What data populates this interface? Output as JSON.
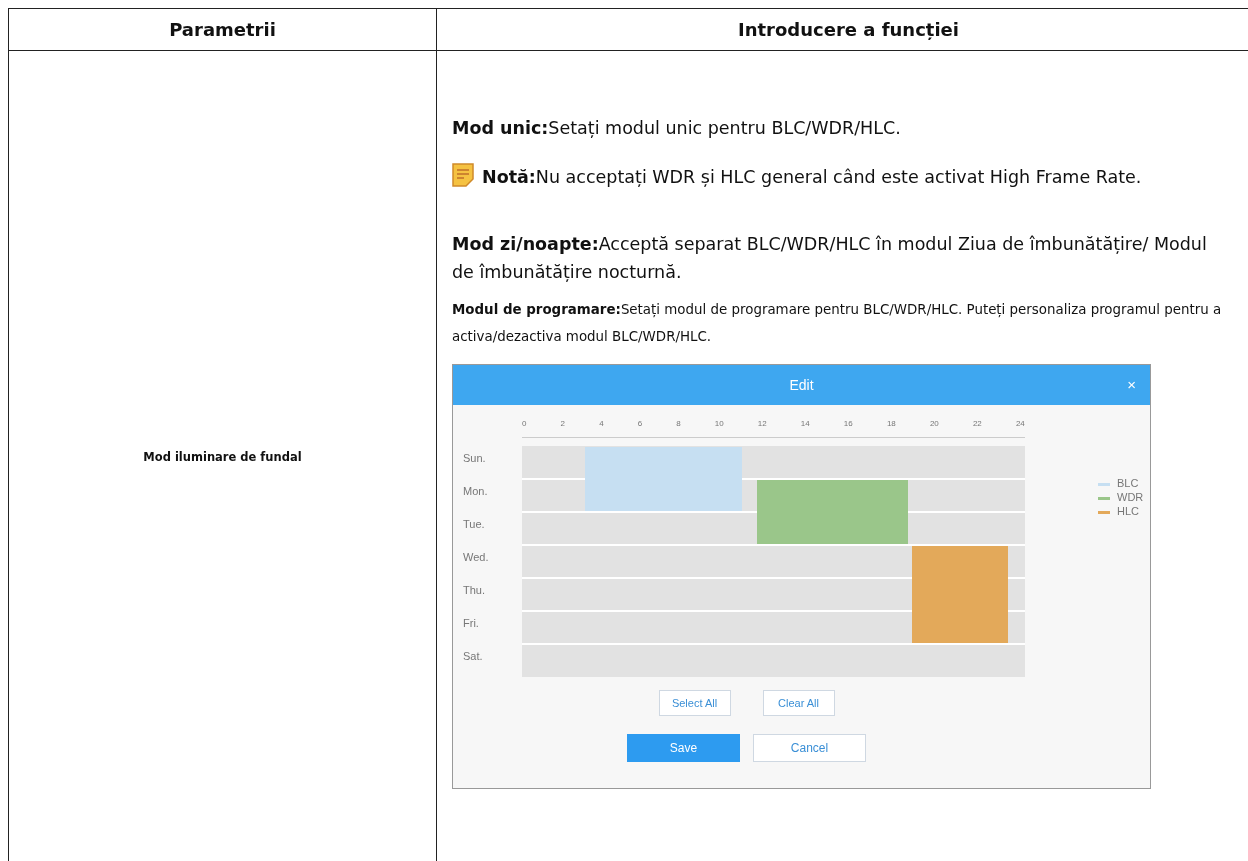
{
  "table": {
    "columns": [
      "Parametrii",
      "Introducere a funcției"
    ],
    "rows": [
      {
        "parameter": "Mod iluminare de fundal",
        "description": [
          {
            "kind": "paragraph",
            "text": "**Mod unic:**Setați modul unic pentru BLC/WDR/HLC."
          },
          {
            "kind": "note",
            "text": "**Notă:**Nu acceptați WDR și HLC general când este activat High Frame Rate."
          },
          {
            "kind": "paragraph",
            "text": "**Mod zi/noapte:**Acceptă separat BLC/WDR/HLC în modul Ziua de îmbunătățire/ Modul de îmbunătățire nocturnă."
          },
          {
            "kind": "small",
            "text": "**Modul de programare:**Setați modul de programare pentru BLC/WDR/HLC. Puteți personaliza programul pentru a activa/dezactiva modul BLC/WDR/HLC."
          }
        ],
        "dialog": {
          "title": "Edit",
          "close": "×",
          "hours": [
            "0",
            "2",
            "4",
            "6",
            "8",
            "10",
            "12",
            "14",
            "16",
            "18",
            "20",
            "22",
            "24"
          ],
          "days": [
            "Sun.",
            "Mon.",
            "Tue.",
            "Wed.",
            "Thu.",
            "Fri.",
            "Sat."
          ],
          "legend": [
            {
              "label": "BLC",
              "color": "#c6dff2"
            },
            {
              "label": "WDR",
              "color": "#9ac68a"
            },
            {
              "label": "HLC",
              "color": "#e3a95a"
            }
          ],
          "grid_buttons": [
            "Select All",
            "Clear All"
          ],
          "save": "Save",
          "cancel": "Cancel"
        }
      }
    ]
  }
}
